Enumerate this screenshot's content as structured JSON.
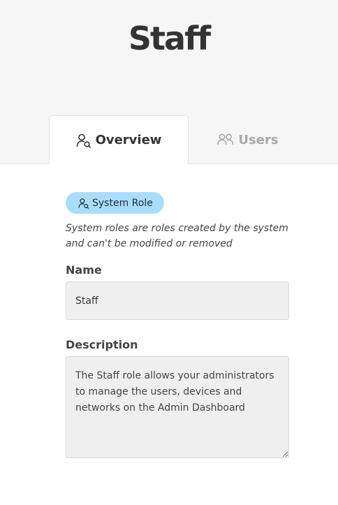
{
  "header": {
    "title": "Staff"
  },
  "tabs": [
    {
      "label": "Overview",
      "icon": "user-key-icon",
      "active": true
    },
    {
      "label": "Users",
      "icon": "users-icon",
      "active": false
    }
  ],
  "role": {
    "badge_label": "System Role",
    "badge_icon": "user-key-icon",
    "badge_color": "#a9ddfc",
    "note": "System roles are roles created by the system and can't be modified or removed"
  },
  "form": {
    "name_label": "Name",
    "name_value": "Staff",
    "description_label": "Description",
    "description_value": "The Staff role allows your administrators to manage the users, devices and networks on the Admin Dashboard"
  }
}
